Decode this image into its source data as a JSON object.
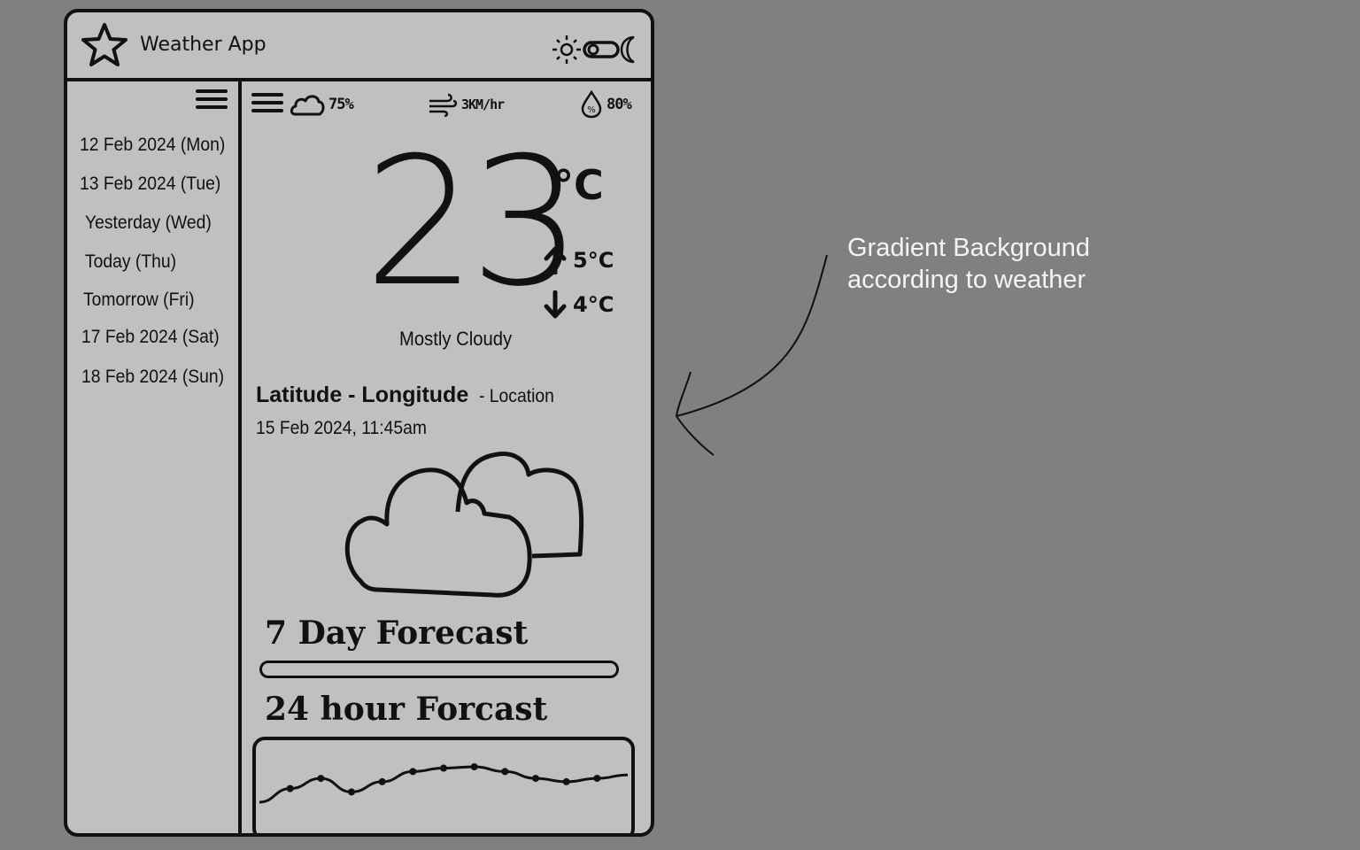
{
  "header": {
    "title": "Weather App"
  },
  "sidebar": {
    "days": [
      "12 Feb 2024 (Mon)",
      "13 Feb 2024 (Tue)",
      "Yesterday (Wed)",
      "Today (Thu)",
      "Tomorrow (Fri)",
      "17 Feb 2024 (Sat)",
      "18 Feb 2024 (Sun)"
    ]
  },
  "stats": {
    "cloud": "75%",
    "wind": "3KM/hr",
    "humidity": "80%"
  },
  "current": {
    "temperature": "23",
    "unit": "°C",
    "high": "5°C",
    "low": "4°C",
    "condition": "Mostly Cloudy"
  },
  "location": {
    "coords": "Latitude - Longitude",
    "suffix": "- Location",
    "datetime": "15 Feb 2024, 11:45am"
  },
  "sections": {
    "seven_day": "7 Day Forecast",
    "hourly": "24 hour Forcast"
  },
  "chart_data": {
    "type": "line",
    "title": "",
    "series": [
      {
        "values": [
          1,
          3,
          4.5,
          2.5,
          4,
          5.5,
          6,
          6.2,
          5.5,
          4.5,
          4,
          4.5,
          5
        ]
      }
    ]
  },
  "annotation": {
    "line1": "Gradient Background",
    "line2": "according to weather"
  },
  "icons": {
    "brand": "star-icon",
    "theme": "sun-moon-toggle-icon",
    "menu": "hamburger-icon",
    "cloud": "cloud-icon",
    "wind": "wind-icon",
    "humidity": "droplet-icon"
  }
}
